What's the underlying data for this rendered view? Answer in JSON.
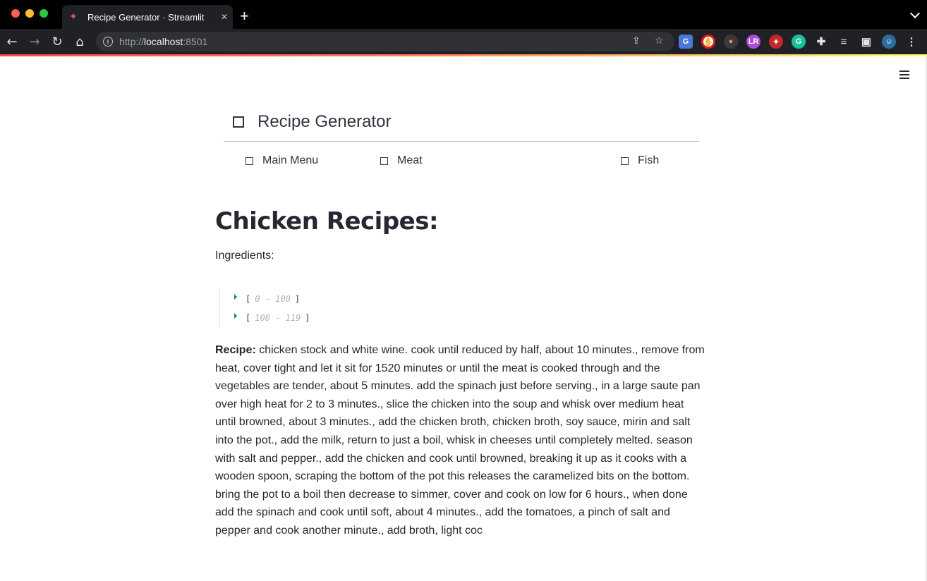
{
  "browser": {
    "tab_title": "Recipe Generator · Streamlit",
    "tab_favicon": "party-popper-icon",
    "new_tab_label": "+",
    "url_scheme": "http://",
    "url_host": "localhost",
    "url_port": ":8501"
  },
  "menu": {
    "title": "Recipe Generator",
    "items": [
      {
        "label": "Main Menu"
      },
      {
        "label": "Meat"
      },
      {
        "label": "Fish"
      }
    ]
  },
  "main": {
    "heading": "Chicken Recipes:",
    "ingredients_label": "Ingredients:",
    "ingredient_groups": [
      {
        "open": "[",
        "range": "0 - 100",
        "close": "]"
      },
      {
        "open": "[",
        "range": "100 - 119",
        "close": "]"
      }
    ],
    "recipe_label": "Recipe:",
    "recipe_text": "chicken stock and white wine. cook until reduced by half, about 10 minutes., remove from heat, cover tight and let it sit for 1520 minutes or until the meat is cooked through and the vegetables are tender, about 5 minutes. add the spinach just before serving., in a large saute pan over high heat for 2 to 3 minutes., slice the chicken into the soup and whisk over medium heat until browned, about 3 minutes., add the chicken broth, chicken broth, soy sauce, mirin and salt into the pot., add the milk, return to just a boil, whisk in cheeses until completely melted. season with salt and pepper., add the chicken and cook until browned, breaking it up as it cooks with a wooden spoon, scraping the bottom of the pot this releases the caramelized bits on the bottom. bring the pot to a boil then decrease to simmer, cover and cook on low for 6 hours., when done add the spinach and cook until soft, about 4 minutes., add the tomatoes, a pinch of salt and pepper and cook another minute., add broth, light coc"
  },
  "colors": {
    "accent_start": "#ff4b4b",
    "accent_end": "#fffd80",
    "text": "#262730",
    "chrome_bg": "#202124"
  }
}
